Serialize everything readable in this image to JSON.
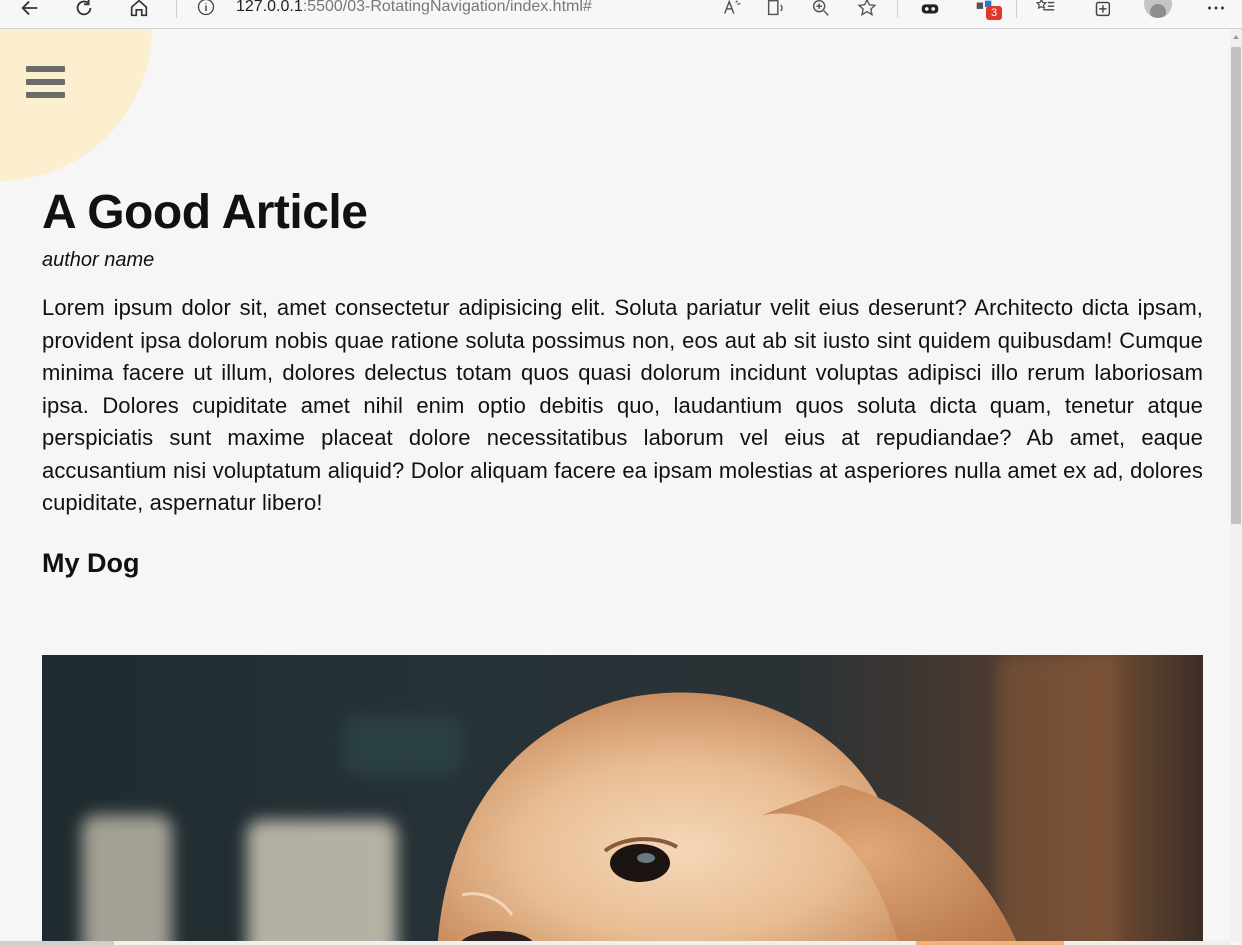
{
  "browser": {
    "url_host": "127.0.0.1",
    "url_path": ":5500/03-RotatingNavigation/index.html#",
    "extensions_badge": "3"
  },
  "page": {
    "title": "A Good Article",
    "author": "author name",
    "body": "Lorem ipsum dolor sit, amet consectetur adipisicing elit. Soluta pariatur velit eius deserunt? Architecto dicta ipsam, provident ipsa dolorum nobis quae ratione soluta possimus non, eos aut ab sit iusto sint quidem quibusdam! Cumque minima facere ut illum, dolores delectus totam quos quasi dolorum incidunt voluptas adipisci illo rerum laboriosam ipsa. Dolores cupiditate amet nihil enim optio debitis quo, laudantium quos soluta dicta quam, tenetur atque perspiciatis sunt maxime placeat dolore necessitatibus laborum vel eius at repudiandae? Ab amet, eaque accusantium nisi voluptatum aliquid? Dolor aliquam facere ea ipsam molestias at asperiores nulla amet ex ad, dolores cupiditate, aspernatur libero!",
    "subheading": "My Dog"
  },
  "colors": {
    "nav_circle": "#fbefd0",
    "hamburger": "#6b6b6b",
    "page_background": "#f6f6f6"
  },
  "icons": {
    "menu": "hamburger-icon",
    "back": "back-arrow-icon",
    "reload": "reload-icon",
    "home": "home-icon",
    "info": "info-icon"
  }
}
